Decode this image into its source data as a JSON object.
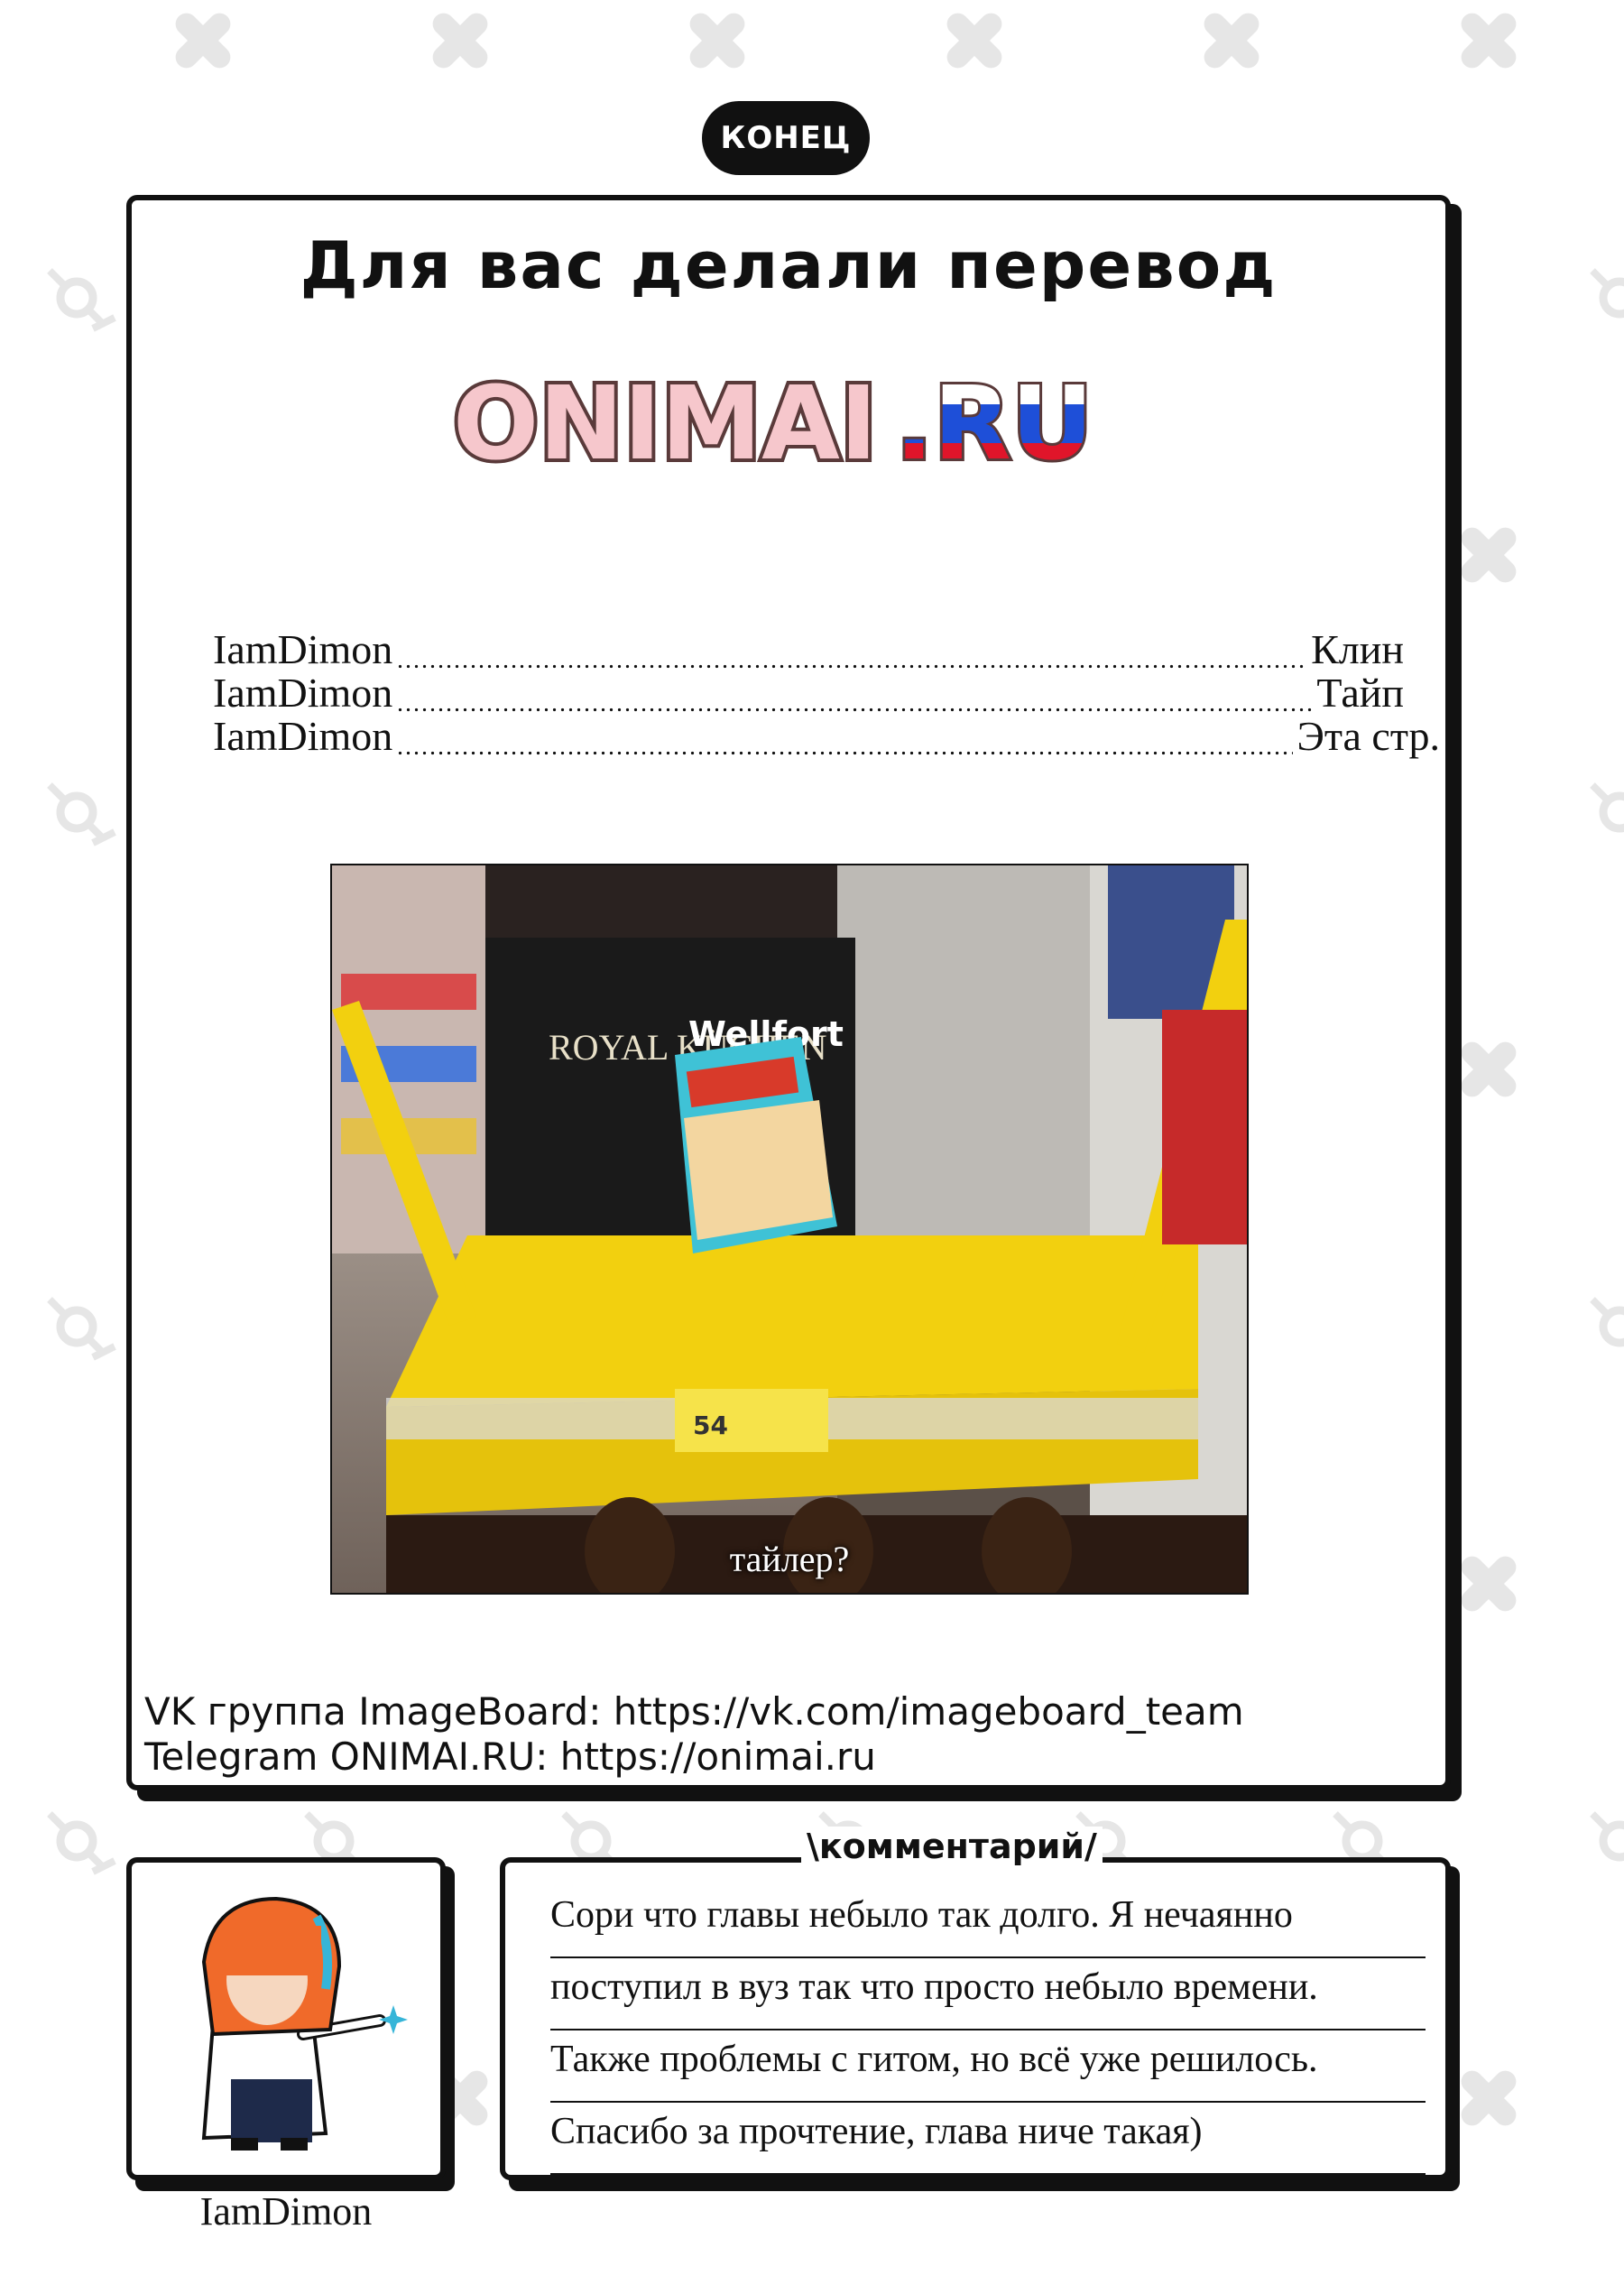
{
  "badge": "КОНЕЦ",
  "title": "Для вас делали перевод",
  "logo": {
    "text_main": "ONIMAI",
    "text_ru": ".RU"
  },
  "credits": [
    {
      "name": "IamDimon",
      "role": "Клин"
    },
    {
      "name": "IamDimon",
      "role": "Тайп"
    },
    {
      "name": "IamDimon",
      "role": "Эта стр."
    }
  ],
  "photo": {
    "caption": "тайлер?",
    "sign_left": "ROYAL KÜCHEN",
    "sign_right": "Wellfort",
    "price": "54"
  },
  "links": [
    "VK группа ImageBoard: https://vk.com/imageboard_team",
    "Telegram ONIMAI.RU: https://onimai.ru"
  ],
  "comment_tag": "\\комментарий/",
  "comment_lines": [
    "Сори что главы небыло так долго. Я нечаянно",
    "поступил в вуз так что просто небыло времени.",
    "Также проблемы с гитом, но всё уже решилось.",
    "Спасибо за прочтение, глава ниче такая)"
  ],
  "author": "IamDimon"
}
